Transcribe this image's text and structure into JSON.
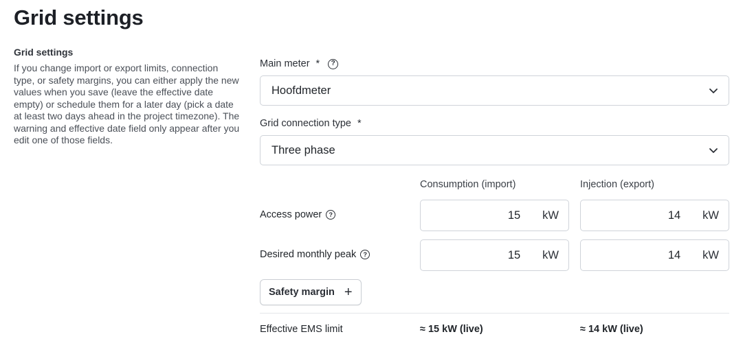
{
  "page": {
    "title": "Grid settings"
  },
  "aside": {
    "title": "Grid settings",
    "description": "If you change import or export limits, connection type, or safety margins, you can either apply the new values when you save (leave the effective date empty) or schedule them for a later day (pick a date at least two days ahead in the project timezone). The warning and effective date field only appear after you edit one of those fields."
  },
  "main_meter": {
    "label": "Main meter",
    "required_marker": "*",
    "value": "Hoofdmeter"
  },
  "grid_connection": {
    "label": "Grid connection type",
    "required_marker": "*",
    "value": "Three phase"
  },
  "columns": {
    "consumption": "Consumption (import)",
    "injection": "Injection (export)"
  },
  "access_power": {
    "label": "Access power",
    "consumption": "15",
    "injection": "14",
    "unit": "kW"
  },
  "monthly_peak": {
    "label": "Desired monthly peak",
    "consumption": "15",
    "injection": "14",
    "unit": "kW"
  },
  "safety_margin": {
    "label": "Safety margin",
    "icon": "plus-icon"
  },
  "ems_limit": {
    "label": "Effective EMS limit",
    "consumption": "≈ 15 kW (live)",
    "injection": "≈ 14 kW (live)"
  },
  "help_icon_glyph": "?"
}
